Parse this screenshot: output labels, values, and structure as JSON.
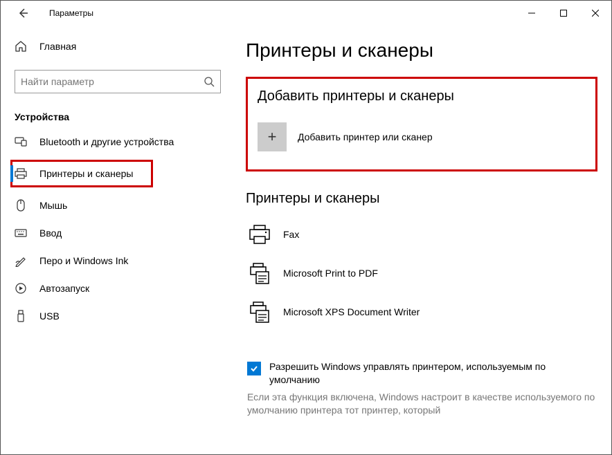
{
  "titlebar": {
    "app_title": "Параметры"
  },
  "sidebar": {
    "home_label": "Главная",
    "search_placeholder": "Найти параметр",
    "category_header": "Устройства",
    "items": [
      {
        "label": "Bluetooth и другие устройства"
      },
      {
        "label": "Принтеры и сканеры"
      },
      {
        "label": "Мышь"
      },
      {
        "label": "Ввод"
      },
      {
        "label": "Перо и Windows Ink"
      },
      {
        "label": "Автозапуск"
      },
      {
        "label": "USB"
      }
    ]
  },
  "main": {
    "page_title": "Принтеры и сканеры",
    "add_section_title": "Добавить принтеры и сканеры",
    "add_button_label": "Добавить принтер или сканер",
    "printers_title": "Принтеры и сканеры",
    "printers": [
      {
        "name": "Fax"
      },
      {
        "name": "Microsoft Print to PDF"
      },
      {
        "name": "Microsoft XPS Document Writer"
      }
    ],
    "checkbox_label": "Разрешить Windows управлять принтером, используемым по умолчанию",
    "description": "Если эта функция включена, Windows настроит в качестве используемого по умолчанию принтера тот принтер, который"
  }
}
